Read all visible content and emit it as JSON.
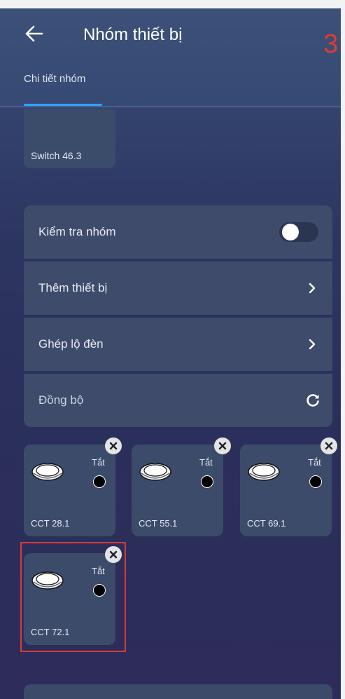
{
  "header": {
    "title": "Nhóm thiết bị",
    "step_number": "3",
    "tab": "Chi tiết nhóm"
  },
  "switch_card": {
    "label": "Switch 46.3"
  },
  "menu": {
    "group_check": {
      "label": "Kiểm tra nhóm",
      "toggle_on": false
    },
    "add_device": {
      "label": "Thêm thiết bị"
    },
    "merge_light": {
      "label": "Ghép lộ đèn"
    },
    "sync": {
      "label": "Đồng bộ"
    }
  },
  "devices": [
    {
      "name": "CCT 28.1",
      "state": "Tắt"
    },
    {
      "name": "CCT 55.1",
      "state": "Tắt"
    },
    {
      "name": "CCT 69.1",
      "state": "Tắt"
    },
    {
      "name": "CCT 72.1",
      "state": "Tắt"
    }
  ],
  "icons": {
    "back": "arrow-left-icon",
    "chevron": "chevron-right-icon",
    "sync": "refresh-icon",
    "remove": "close-icon",
    "lamp": "ceiling-lamp-icon"
  },
  "colors": {
    "tab_indicator": "#2ea3ff",
    "highlight": "#d63a3a",
    "step_number": "#e03b34"
  }
}
